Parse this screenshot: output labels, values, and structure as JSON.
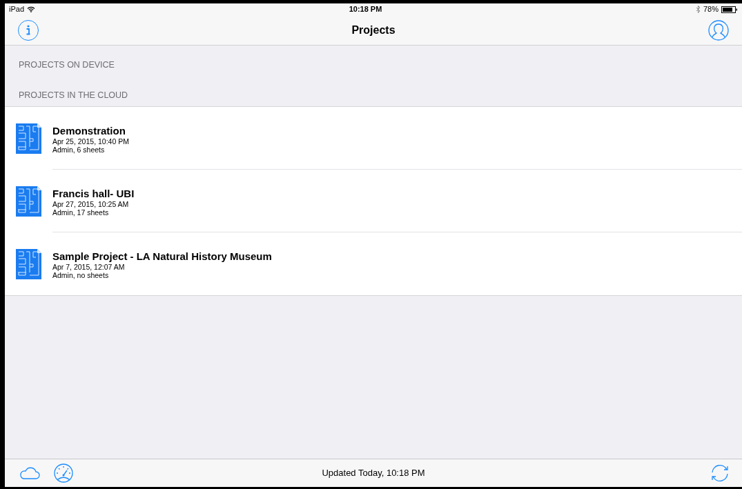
{
  "status_bar": {
    "device": "iPad",
    "time": "10:18 PM",
    "battery": "78%"
  },
  "nav_bar": {
    "title": "Projects"
  },
  "sections": [
    {
      "header": "PROJECTS ON DEVICE"
    },
    {
      "header": "PROJECTS IN THE CLOUD",
      "projects": [
        {
          "name": "Demonstration",
          "date": "Apr 25, 2015, 10:40 PM",
          "details": "Admin, 6 sheets"
        },
        {
          "name": "Francis hall- UBI",
          "date": "Apr 27, 2015, 10:25 AM",
          "details": "Admin, 17 sheets"
        },
        {
          "name": "Sample Project - LA Natural History Museum",
          "date": "Apr 7, 2015, 12:07 AM",
          "details": "Admin, no sheets"
        }
      ]
    }
  ],
  "toolbar": {
    "status": "Updated Today, 10:18 PM"
  }
}
